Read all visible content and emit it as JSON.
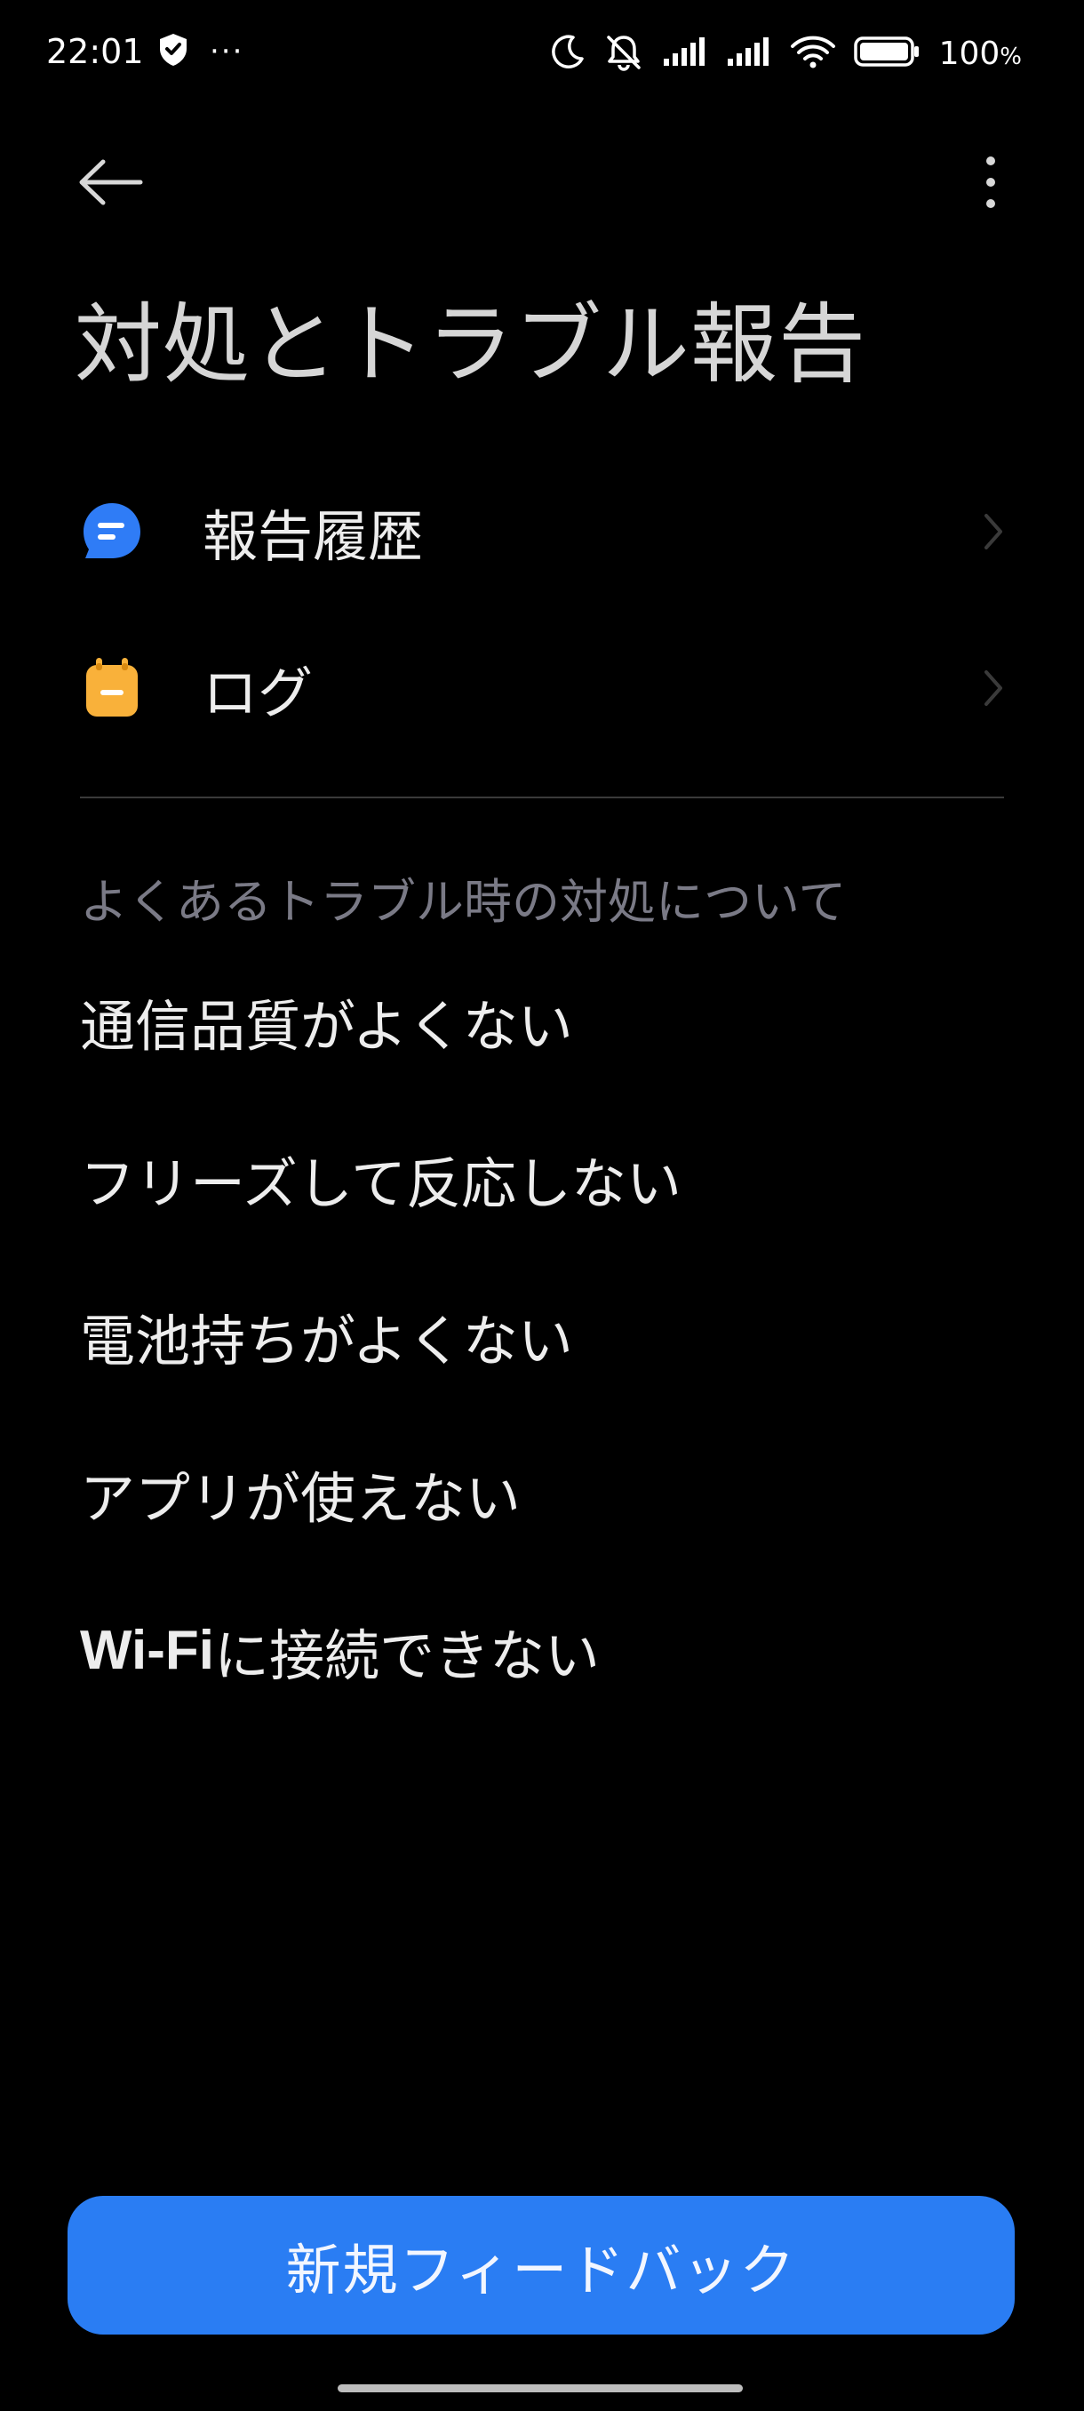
{
  "status_bar": {
    "time": "22:01",
    "ellipsis": "···",
    "battery_value": "100",
    "battery_pct": "%"
  },
  "toolbar": {
    "back_icon": "arrow-left-icon",
    "more_icon": "more-vertical-icon"
  },
  "page": {
    "title": "対処とトラブル報告"
  },
  "menu": {
    "items": [
      {
        "label": "報告履歴",
        "icon": "chat-bubble-icon",
        "icon_color": "#2f7cf6"
      },
      {
        "label": "ログ",
        "icon": "calendar-log-icon",
        "icon_color": "#f9b13a"
      }
    ]
  },
  "faq": {
    "header": "よくあるトラブル時の対処について",
    "items": [
      "通信品質がよくない",
      "フリーズして反応しない",
      "電池持ちがよくない",
      "アプリが使えない"
    ],
    "wifi_item": {
      "latin": "Wi-Fi",
      "rest": "に接続できない"
    }
  },
  "footer": {
    "button_label": "新規フィードバック",
    "button_color": "#2a7df3"
  }
}
